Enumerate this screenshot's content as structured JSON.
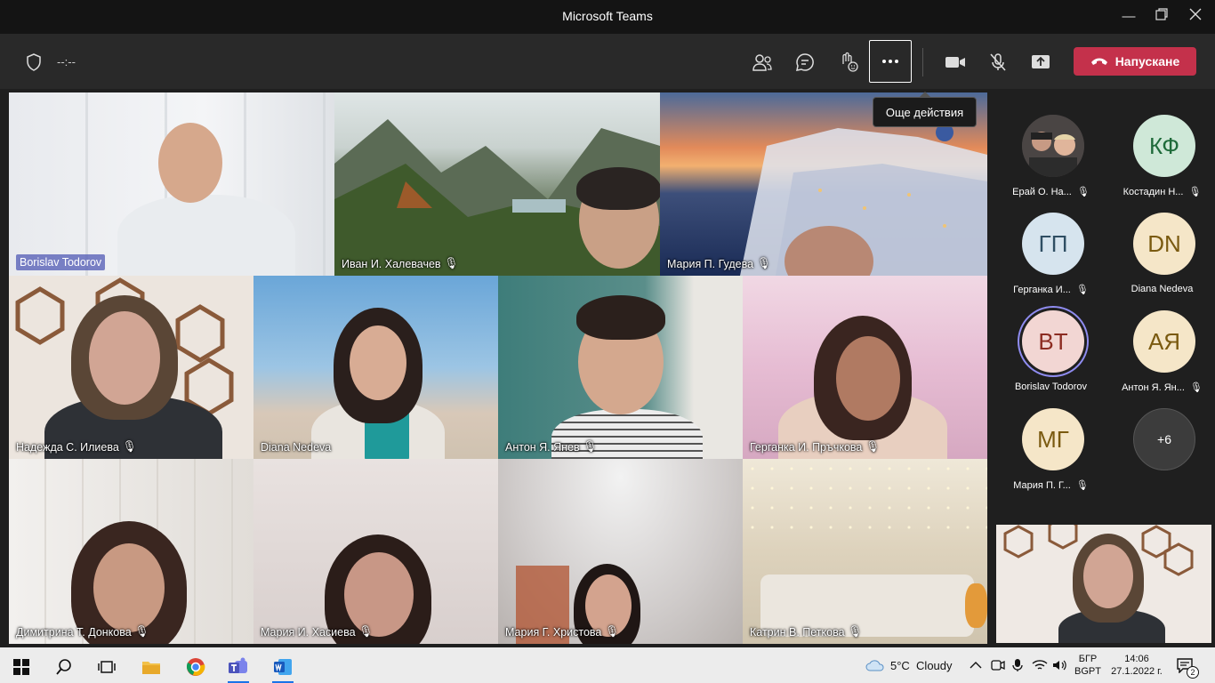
{
  "window": {
    "title": "Microsoft Teams"
  },
  "toolbar": {
    "timer": "--:--",
    "tooltip": "Още действия",
    "leave_label": "Напускане"
  },
  "tiles": [
    {
      "name": "Borislav Todorov",
      "muted": false,
      "boxed": true
    },
    {
      "name": "Иван И. Халевачев",
      "muted": true
    },
    {
      "name": "Мария П. Гудева",
      "muted": true
    },
    {
      "name": "Надежда С. Илиева",
      "muted": true
    },
    {
      "name": "Diana Nedeva",
      "muted": false,
      "boxed": false
    },
    {
      "name": "Антон Я. Янев",
      "muted": true
    },
    {
      "name": "Герганка И. Пръчкова",
      "muted": true
    },
    {
      "name": "Димитрина Т. Донкова",
      "muted": true
    },
    {
      "name": "Мария И. Хасиева",
      "muted": true
    },
    {
      "name": "Мария Г. Христова",
      "muted": true
    },
    {
      "name": "Катрин В. Петкова",
      "muted": true
    }
  ],
  "roster": [
    {
      "initials": "",
      "name": "Ерай О. На...",
      "muted": true,
      "bg": "#3a3a3a",
      "fg": "#fff"
    },
    {
      "initials": "КФ",
      "name": "Костадин Н...",
      "muted": true,
      "bg": "#cfe8d8",
      "fg": "#1f6b3a"
    },
    {
      "initials": "ГП",
      "name": "Герганка И...",
      "muted": true,
      "bg": "#d6e4ee",
      "fg": "#2f4e63"
    },
    {
      "initials": "DN",
      "name": "Diana Nedeva",
      "muted": false,
      "bg": "#f5e6c8",
      "fg": "#7a5a10"
    },
    {
      "initials": "BT",
      "name": "Borislav Todorov",
      "muted": false,
      "bg": "#f2d6d3",
      "fg": "#8c2c22",
      "speaking": true
    },
    {
      "initials": "АЯ",
      "name": "Антон Я. Ян...",
      "muted": true,
      "bg": "#f5e6c8",
      "fg": "#7a5a10"
    },
    {
      "initials": "МГ",
      "name": "Мария П. Г...",
      "muted": true,
      "bg": "#f5e6c8",
      "fg": "#7a5a10"
    },
    {
      "initials": "+6",
      "name": "",
      "muted": false,
      "bg": "#3c3c3c",
      "fg": "#fff"
    }
  ],
  "taskbar": {
    "weather": "5°C  Cloudy",
    "lang_top": "БГР",
    "lang_bottom": "BGPT",
    "time": "14:06",
    "date": "27.1.2022 г.",
    "notifications": "2"
  }
}
